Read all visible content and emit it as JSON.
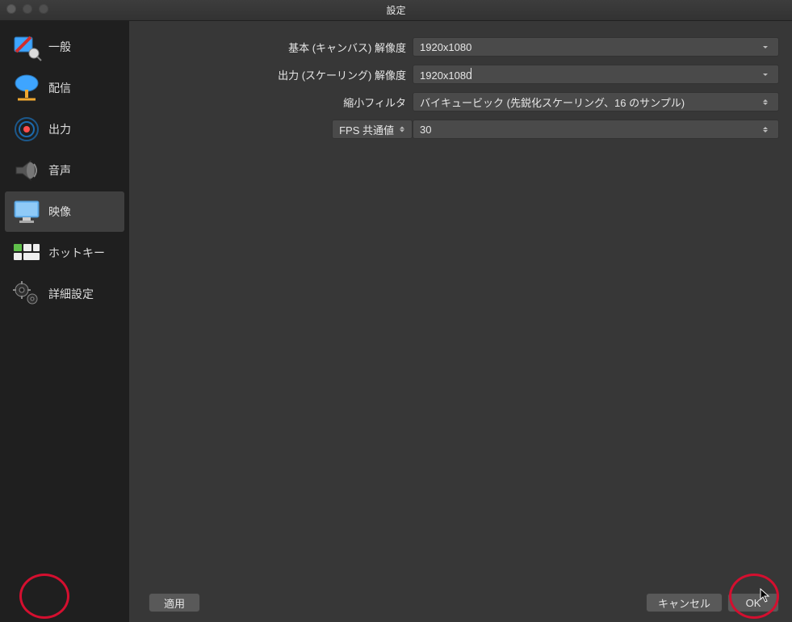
{
  "window": {
    "title": "設定"
  },
  "sidebar": {
    "items": [
      {
        "label": "一般"
      },
      {
        "label": "配信"
      },
      {
        "label": "出力"
      },
      {
        "label": "音声"
      },
      {
        "label": "映像"
      },
      {
        "label": "ホットキー"
      },
      {
        "label": "詳細設定"
      }
    ]
  },
  "form": {
    "base_resolution": {
      "label": "基本 (キャンバス) 解像度",
      "value": "1920x1080"
    },
    "output_resolution": {
      "label": "出力 (スケーリング) 解像度",
      "value": "1920x1080"
    },
    "downscale_filter": {
      "label": "縮小フィルタ",
      "value": "バイキュービック (先鋭化スケーリング、16 のサンプル)"
    },
    "fps_type": {
      "label": "FPS 共通値"
    },
    "fps_value": "30"
  },
  "buttons": {
    "apply": "適用",
    "cancel": "キャンセル",
    "ok": "OK"
  }
}
